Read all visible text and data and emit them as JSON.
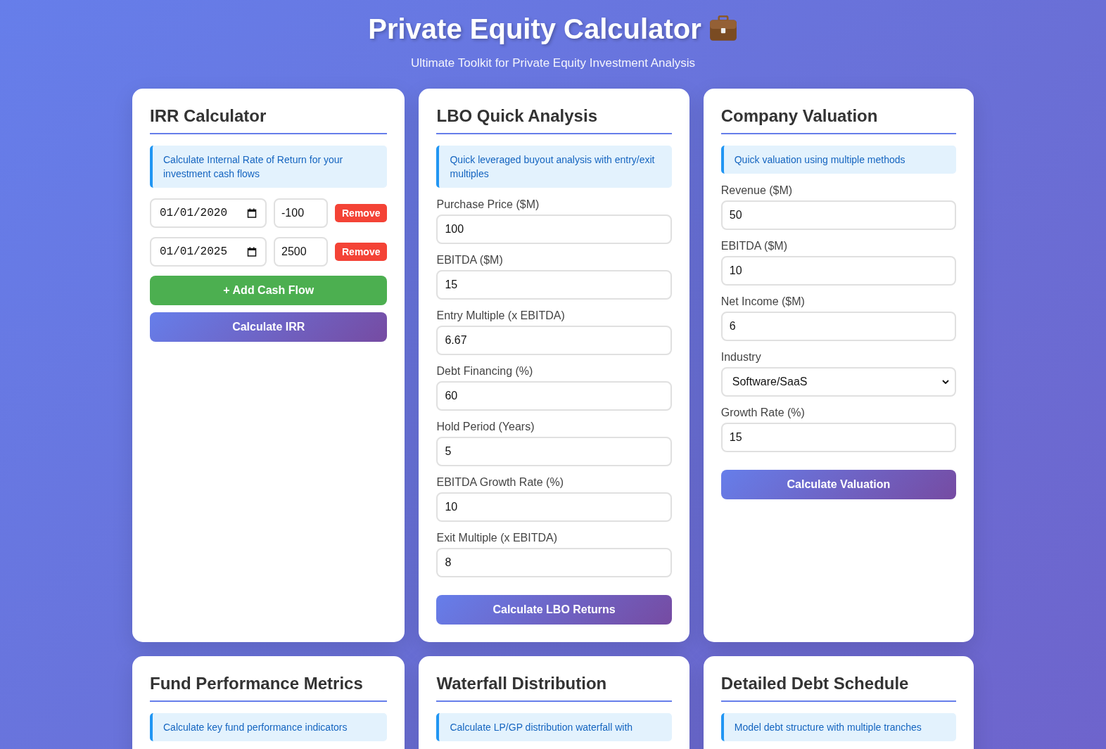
{
  "header": {
    "title": "Private Equity Calculator",
    "subtitle": "Ultimate Toolkit for Private Equity Investment Analysis"
  },
  "cards": [
    {
      "kind": "irr",
      "title": "IRR Calculator",
      "info": "Calculate Internal Rate of Return for your investment cash flows",
      "cash_flows": [
        {
          "date": "01/01/2020",
          "amount": "-100",
          "remove": "Remove"
        },
        {
          "date": "01/01/2025",
          "amount": "2500",
          "remove": "Remove"
        }
      ],
      "add_button": "+ Add Cash Flow",
      "button": "Calculate IRR"
    },
    {
      "kind": "form",
      "title": "LBO Quick Analysis",
      "info": "Quick leveraged buyout analysis with entry/exit multiples",
      "fields": [
        {
          "kind": "input",
          "label": "Purchase Price ($M)",
          "value": "100"
        },
        {
          "kind": "input",
          "label": "EBITDA ($M)",
          "value": "15"
        },
        {
          "kind": "input",
          "label": "Entry Multiple (x EBITDA)",
          "value": "6.67"
        },
        {
          "kind": "input",
          "label": "Debt Financing (%)",
          "value": "60"
        },
        {
          "kind": "input",
          "label": "Hold Period (Years)",
          "value": "5"
        },
        {
          "kind": "input",
          "label": "EBITDA Growth Rate (%)",
          "value": "10"
        },
        {
          "kind": "input",
          "label": "Exit Multiple (x EBITDA)",
          "value": "8"
        }
      ],
      "button": "Calculate LBO Returns"
    },
    {
      "kind": "form",
      "title": "Company Valuation",
      "info": "Quick valuation using multiple methods",
      "fields": [
        {
          "kind": "input",
          "label": "Revenue ($M)",
          "value": "50"
        },
        {
          "kind": "input",
          "label": "EBITDA ($M)",
          "value": "10"
        },
        {
          "kind": "input",
          "label": "Net Income ($M)",
          "value": "6"
        },
        {
          "kind": "select",
          "label": "Industry",
          "value": "Software/SaaS"
        },
        {
          "kind": "input",
          "label": "Growth Rate (%)",
          "value": "15"
        }
      ],
      "button": "Calculate Valuation"
    },
    {
      "kind": "form",
      "title": "Fund Performance Metrics",
      "info": "Calculate key fund performance indicators"
    },
    {
      "kind": "form",
      "title": "Waterfall Distribution",
      "info": "Calculate LP/GP distribution waterfall with"
    },
    {
      "kind": "form",
      "title": "Detailed Debt Schedule",
      "info": "Model debt structure with multiple tranches"
    }
  ]
}
